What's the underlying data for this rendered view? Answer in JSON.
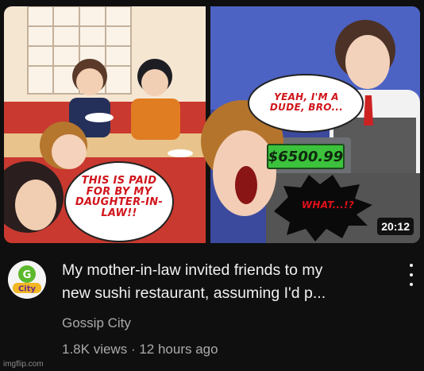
{
  "video": {
    "thumbnail": {
      "left_bubble": "THIS IS PAID FOR BY MY DAUGHTER-IN-LAW!!",
      "right_bubble": "YEAH, I'M A DUDE, BRO...",
      "price_display": "$6500.99",
      "exclaim_bubble": "WHAT...!?",
      "duration": "20:12"
    },
    "title_line1": "My mother-in-law invited friends to my",
    "title_line2": "new sushi restaurant, assuming I'd p...",
    "channel_name": "Gossip City",
    "views": "1.8K views",
    "separator": "·",
    "age": "12 hours ago",
    "avatar_text": "G City"
  },
  "watermark": "imgflip.com",
  "colors": {
    "background": "#0f0f0f",
    "title": "#f1f1f1",
    "secondary_text": "#aaaaaa",
    "bubble_text": "#d0141b",
    "price_green": "#3cc23c"
  },
  "icons": {
    "more_menu": "kebab-vertical-icon"
  }
}
